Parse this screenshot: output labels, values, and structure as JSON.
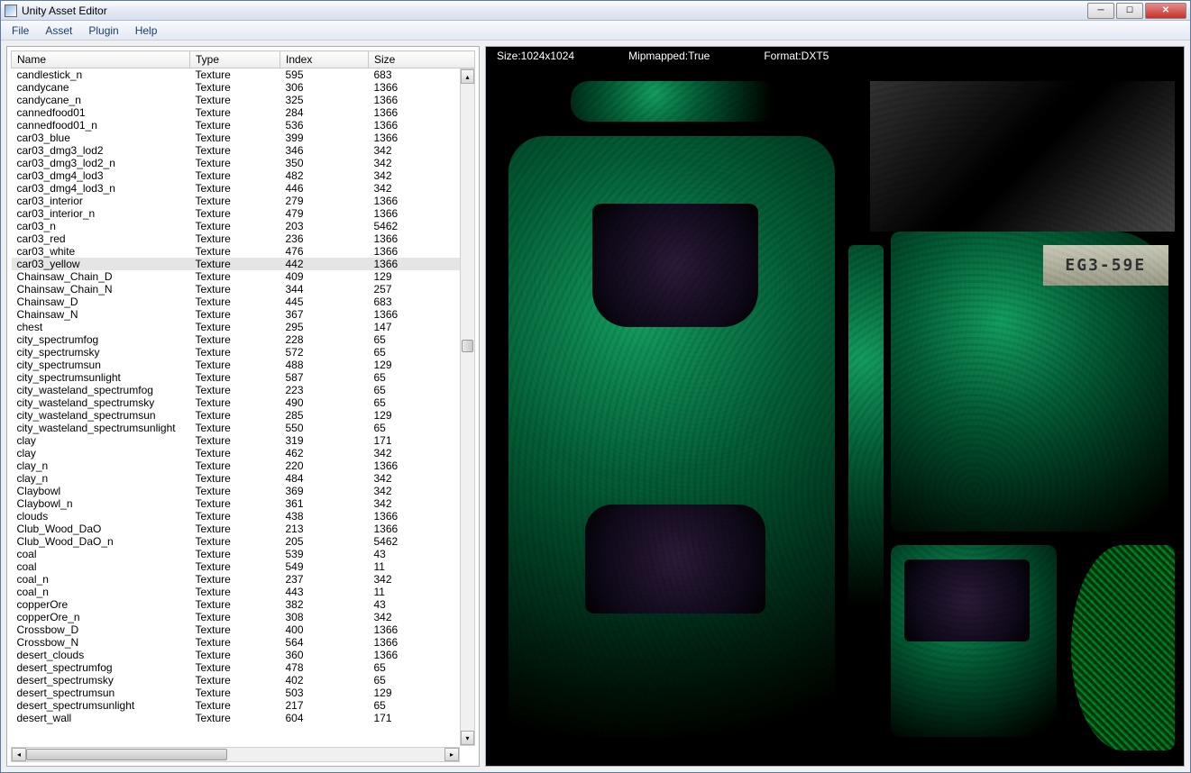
{
  "window": {
    "title": "Unity Asset Editor"
  },
  "menu": {
    "items": [
      "File",
      "Asset",
      "Plugin",
      "Help"
    ]
  },
  "table": {
    "headers": [
      "Name",
      "Type",
      "Index",
      "Size"
    ],
    "selected_name": "car03_yellow",
    "rows": [
      {
        "name": "candlestick_n",
        "type": "Texture",
        "index": "595",
        "size": "683"
      },
      {
        "name": "candycane",
        "type": "Texture",
        "index": "306",
        "size": "1366"
      },
      {
        "name": "candycane_n",
        "type": "Texture",
        "index": "325",
        "size": "1366"
      },
      {
        "name": "cannedfood01",
        "type": "Texture",
        "index": "284",
        "size": "1366"
      },
      {
        "name": "cannedfood01_n",
        "type": "Texture",
        "index": "536",
        "size": "1366"
      },
      {
        "name": "car03_blue",
        "type": "Texture",
        "index": "399",
        "size": "1366"
      },
      {
        "name": "car03_dmg3_lod2",
        "type": "Texture",
        "index": "346",
        "size": "342"
      },
      {
        "name": "car03_dmg3_lod2_n",
        "type": "Texture",
        "index": "350",
        "size": "342"
      },
      {
        "name": "car03_dmg4_lod3",
        "type": "Texture",
        "index": "482",
        "size": "342"
      },
      {
        "name": "car03_dmg4_lod3_n",
        "type": "Texture",
        "index": "446",
        "size": "342"
      },
      {
        "name": "car03_interior",
        "type": "Texture",
        "index": "279",
        "size": "1366"
      },
      {
        "name": "car03_interior_n",
        "type": "Texture",
        "index": "479",
        "size": "1366"
      },
      {
        "name": "car03_n",
        "type": "Texture",
        "index": "203",
        "size": "5462"
      },
      {
        "name": "car03_red",
        "type": "Texture",
        "index": "236",
        "size": "1366"
      },
      {
        "name": "car03_white",
        "type": "Texture",
        "index": "476",
        "size": "1366"
      },
      {
        "name": "car03_yellow",
        "type": "Texture",
        "index": "442",
        "size": "1366"
      },
      {
        "name": "Chainsaw_Chain_D",
        "type": "Texture",
        "index": "409",
        "size": "129"
      },
      {
        "name": "Chainsaw_Chain_N",
        "type": "Texture",
        "index": "344",
        "size": "257"
      },
      {
        "name": "Chainsaw_D",
        "type": "Texture",
        "index": "445",
        "size": "683"
      },
      {
        "name": "Chainsaw_N",
        "type": "Texture",
        "index": "367",
        "size": "1366"
      },
      {
        "name": "chest",
        "type": "Texture",
        "index": "295",
        "size": "147"
      },
      {
        "name": "city_spectrumfog",
        "type": "Texture",
        "index": "228",
        "size": "65"
      },
      {
        "name": "city_spectrumsky",
        "type": "Texture",
        "index": "572",
        "size": "65"
      },
      {
        "name": "city_spectrumsun",
        "type": "Texture",
        "index": "488",
        "size": "129"
      },
      {
        "name": "city_spectrumsunlight",
        "type": "Texture",
        "index": "587",
        "size": "65"
      },
      {
        "name": "city_wasteland_spectrumfog",
        "type": "Texture",
        "index": "223",
        "size": "65"
      },
      {
        "name": "city_wasteland_spectrumsky",
        "type": "Texture",
        "index": "490",
        "size": "65"
      },
      {
        "name": "city_wasteland_spectrumsun",
        "type": "Texture",
        "index": "285",
        "size": "129"
      },
      {
        "name": "city_wasteland_spectrumsunlight",
        "type": "Texture",
        "index": "550",
        "size": "65"
      },
      {
        "name": "clay",
        "type": "Texture",
        "index": "319",
        "size": "171"
      },
      {
        "name": "clay",
        "type": "Texture",
        "index": "462",
        "size": "342"
      },
      {
        "name": "clay_n",
        "type": "Texture",
        "index": "220",
        "size": "1366"
      },
      {
        "name": "clay_n",
        "type": "Texture",
        "index": "484",
        "size": "342"
      },
      {
        "name": "Claybowl",
        "type": "Texture",
        "index": "369",
        "size": "342"
      },
      {
        "name": "Claybowl_n",
        "type": "Texture",
        "index": "361",
        "size": "342"
      },
      {
        "name": "clouds",
        "type": "Texture",
        "index": "438",
        "size": "1366"
      },
      {
        "name": "Club_Wood_DaO",
        "type": "Texture",
        "index": "213",
        "size": "1366"
      },
      {
        "name": "Club_Wood_DaO_n",
        "type": "Texture",
        "index": "205",
        "size": "5462"
      },
      {
        "name": "coal",
        "type": "Texture",
        "index": "539",
        "size": "43"
      },
      {
        "name": "coal",
        "type": "Texture",
        "index": "549",
        "size": "11"
      },
      {
        "name": "coal_n",
        "type": "Texture",
        "index": "237",
        "size": "342"
      },
      {
        "name": "coal_n",
        "type": "Texture",
        "index": "443",
        "size": "11"
      },
      {
        "name": "copperOre",
        "type": "Texture",
        "index": "382",
        "size": "43"
      },
      {
        "name": "copperOre_n",
        "type": "Texture",
        "index": "308",
        "size": "342"
      },
      {
        "name": "Crossbow_D",
        "type": "Texture",
        "index": "400",
        "size": "1366"
      },
      {
        "name": "Crossbow_N",
        "type": "Texture",
        "index": "564",
        "size": "1366"
      },
      {
        "name": "desert_clouds",
        "type": "Texture",
        "index": "360",
        "size": "1366"
      },
      {
        "name": "desert_spectrumfog",
        "type": "Texture",
        "index": "478",
        "size": "65"
      },
      {
        "name": "desert_spectrumsky",
        "type": "Texture",
        "index": "402",
        "size": "65"
      },
      {
        "name": "desert_spectrumsun",
        "type": "Texture",
        "index": "503",
        "size": "129"
      },
      {
        "name": "desert_spectrumsunlight",
        "type": "Texture",
        "index": "217",
        "size": "65"
      },
      {
        "name": "desert_wall",
        "type": "Texture",
        "index": "604",
        "size": "171"
      }
    ]
  },
  "preview": {
    "size_label": "Size:1024x1024",
    "mip_label": "Mipmapped:True",
    "format_label": "Format:DXT5",
    "plate_text": "EG3-59E"
  }
}
